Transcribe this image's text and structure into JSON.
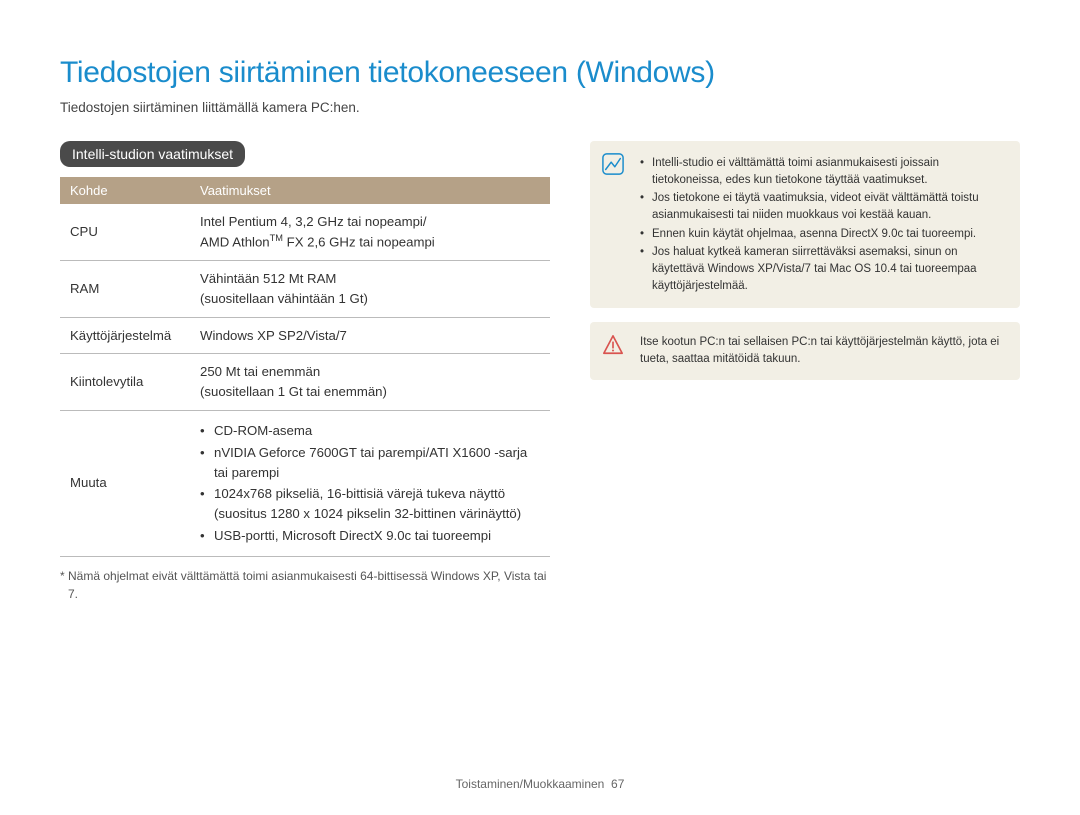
{
  "title": "Tiedostojen siirtäminen tietokoneeseen (Windows)",
  "subtitle": "Tiedostojen siirtäminen liittämällä kamera PC:hen.",
  "section_heading": "Intelli-studion vaatimukset",
  "table": {
    "headers": {
      "col1": "Kohde",
      "col2": "Vaatimukset"
    },
    "rows": {
      "cpu": {
        "label": "CPU",
        "line1": "Intel Pentium 4, 3,2 GHz tai nopeampi/",
        "line2a": "AMD Athlon",
        "line2b": " FX 2,6 GHz tai nopeampi",
        "tm": "TM"
      },
      "ram": {
        "label": "RAM",
        "line1": "Vähintään 512 Mt RAM",
        "line2": "(suositellaan vähintään 1 Gt)"
      },
      "os": {
        "label": "Käyttöjärjestelmä",
        "value": "Windows XP SP2/Vista/7"
      },
      "hdd": {
        "label": "Kiintolevytila",
        "line1": "250 Mt tai enemmän",
        "line2": "(suositellaan 1 Gt tai enemmän)"
      },
      "other": {
        "label": "Muuta",
        "items": {
          "i1": "CD-ROM-asema",
          "i2": "nVIDIA Geforce 7600GT tai parempi/ATI X1600 -sarja tai parempi",
          "i3": "1024x768 pikseliä, 16-bittisiä värejä tukeva näyttö (suositus 1280 x 1024 pikselin 32-bittinen värinäyttö)",
          "i4": "USB-portti, Microsoft DirectX 9.0c tai tuoreempi"
        }
      }
    }
  },
  "footnote": "* Nämä ohjelmat eivät välttämättä toimi asianmukaisesti 64-bittisessä Windows XP, Vista tai 7.",
  "info_box": {
    "items": {
      "n1": "Intelli-studio ei välttämättä toimi asianmukaisesti joissain tietokoneissa, edes kun tietokone täyttää vaatimukset.",
      "n2": "Jos tietokone ei täytä vaatimuksia, videot eivät välttämättä toistu asianmukaisesti tai niiden muokkaus voi kestää kauan.",
      "n3": "Ennen kuin käytät ohjelmaa, asenna DirectX 9.0c tai tuoreempi.",
      "n4": "Jos haluat kytkeä kameran siirrettäväksi asemaksi, sinun on käytettävä Windows XP/Vista/7 tai Mac OS 10.4 tai tuoreempaa käyttöjärjestelmää."
    }
  },
  "warn_box": {
    "text": "Itse kootun PC:n tai sellaisen PC:n tai käyttöjärjestelmän käyttö, jota ei tueta, saattaa mitätöidä takuun."
  },
  "footer": {
    "section": "Toistaminen/Muokkaaminen",
    "page": "67"
  }
}
